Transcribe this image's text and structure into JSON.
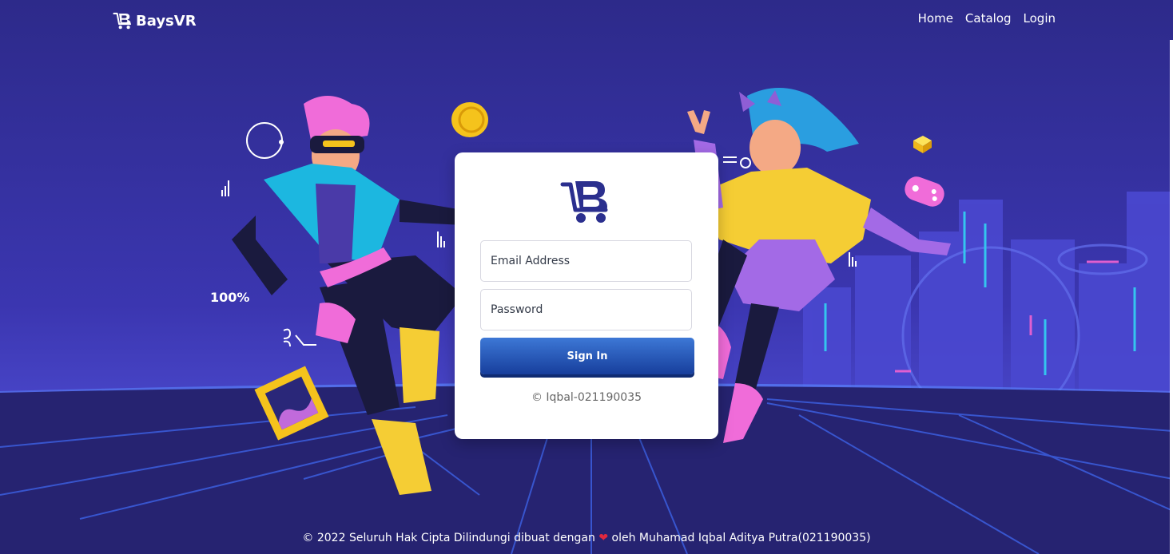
{
  "colors": {
    "background_top": "#2d2a8a",
    "background_bottom": "#3c35b5",
    "floor": "#25236a",
    "button_gradient": [
      "#3d78d6",
      "#173e9c"
    ],
    "logo_color": "#2b2f8e"
  },
  "brand": {
    "name": "BaysVR",
    "icon": "cart-b-logo-icon"
  },
  "nav": {
    "items": [
      {
        "label": "Home"
      },
      {
        "label": "Catalog"
      },
      {
        "label": "Login"
      }
    ]
  },
  "login_form": {
    "logo_icon": "cart-b-logo-icon",
    "email_placeholder": "Email Address",
    "password_placeholder": "Password",
    "submit_label": "Sign In",
    "copyright": "© Iqbal-021190035"
  },
  "hero": {
    "stat_text": "100%"
  },
  "footer": {
    "text_before": "© 2022 Seluruh Hak Cipta Dilindungi dibuat dengan",
    "heart": "❤",
    "text_after": "oleh Muhamad Iqbal Aditya Putra(021190035)"
  }
}
